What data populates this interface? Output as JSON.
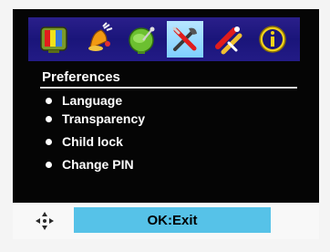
{
  "menu_bar": {
    "icons": [
      {
        "name": "picture-icon",
        "active": false
      },
      {
        "name": "sound-icon",
        "active": false
      },
      {
        "name": "satellite-dish-icon",
        "active": false
      },
      {
        "name": "tools-icon",
        "active": true
      },
      {
        "name": "installation-icon",
        "active": false
      },
      {
        "name": "info-icon",
        "active": false
      }
    ],
    "active_color": "#9fdcff",
    "bar_color": "#1f1882"
  },
  "section": {
    "title": "Preferences"
  },
  "menu_items": [
    {
      "label": "Language"
    },
    {
      "label": "Transparency"
    },
    {
      "label": "Child lock"
    },
    {
      "label": "Change PIN"
    }
  ],
  "footer": {
    "nav_icon": "navigation-arrows-icon",
    "exit_label": "OK:Exit",
    "exit_color": "#56c2e8"
  }
}
